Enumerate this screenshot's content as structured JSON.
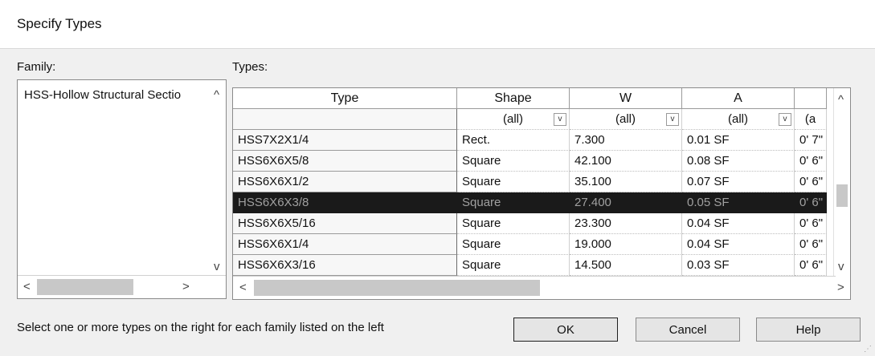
{
  "dialog": {
    "title": "Specify Types"
  },
  "family": {
    "label": "Family:",
    "items": [
      "HSS-Hollow Structural Sectio"
    ],
    "scroll_up": "^",
    "scroll_down": "v",
    "scroll_left": "<",
    "scroll_right": ">"
  },
  "types": {
    "label": "Types:",
    "columns": [
      "Type",
      "Shape",
      "W",
      "A",
      ""
    ],
    "filters": [
      "",
      "(all)",
      "(all)",
      "(all)",
      "(a"
    ],
    "dropdown_glyph": "v",
    "rows": [
      [
        "HSS7X2X1/4",
        "Rect.",
        "7.300",
        "0.01 SF",
        "0'  7\""
      ],
      [
        "HSS6X6X5/8",
        "Square",
        "42.100",
        "0.08 SF",
        "0'  6\""
      ],
      [
        "HSS6X6X1/2",
        "Square",
        "35.100",
        "0.07 SF",
        "0'  6\""
      ],
      [
        "HSS6X6X3/8",
        "Square",
        "27.400",
        "0.05 SF",
        "0'  6\""
      ],
      [
        "HSS6X6X5/16",
        "Square",
        "23.300",
        "0.04 SF",
        "0'  6\""
      ],
      [
        "HSS6X6X1/4",
        "Square",
        "19.000",
        "0.04 SF",
        "0'  6\""
      ],
      [
        "HSS6X6X3/16",
        "Square",
        "14.500",
        "0.03 SF",
        "0'  6\""
      ]
    ],
    "selected_row_index": 3,
    "scroll_up": "^",
    "scroll_down": "v",
    "scroll_left": "<",
    "scroll_right": ">"
  },
  "footer": {
    "instruction": "Select one or more types on the right for each family listed on the left",
    "ok": "OK",
    "cancel": "Cancel",
    "help": "Help"
  },
  "colors": {
    "selection_background": "#1a1a1a",
    "dialog_background": "#f0f0f0"
  }
}
